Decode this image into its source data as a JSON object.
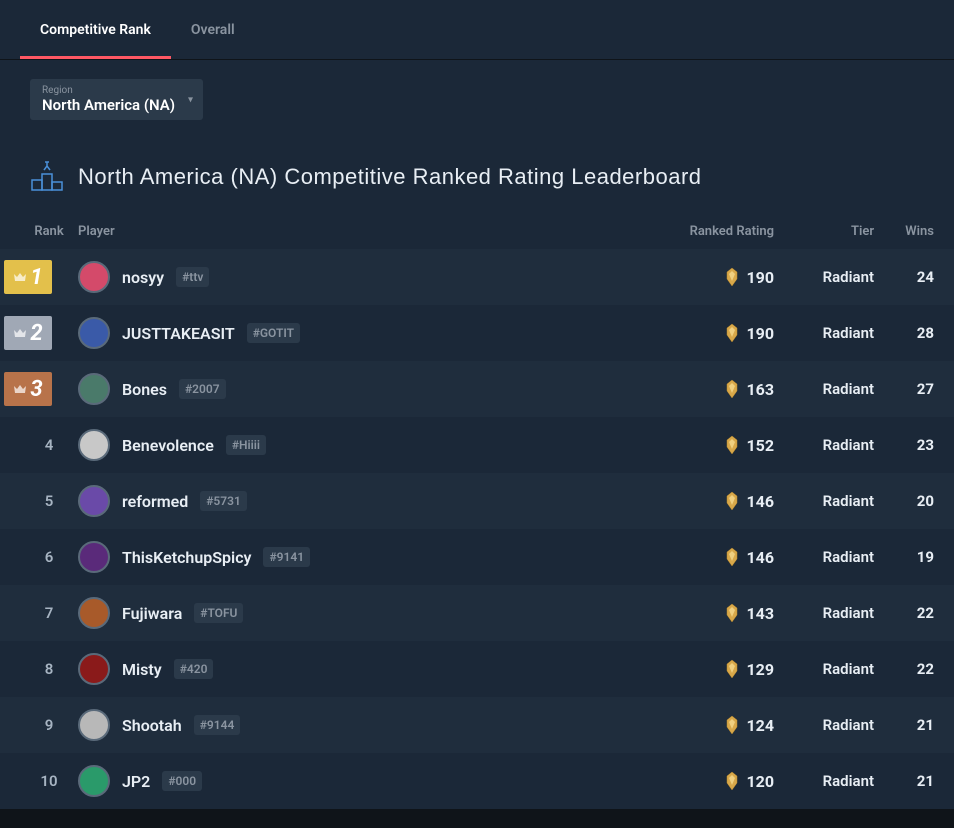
{
  "tabs": {
    "competitive": "Competitive Rank",
    "overall": "Overall"
  },
  "region": {
    "label": "Region",
    "value": "North America (NA)"
  },
  "heading": "North America (NA) Competitive Ranked Rating Leaderboard",
  "columns": {
    "rank": "Rank",
    "player": "Player",
    "rating": "Ranked Rating",
    "tier": "Tier",
    "wins": "Wins"
  },
  "rows": [
    {
      "rank": 1,
      "name": "nosyy",
      "tag": "#ttv",
      "rating": 190,
      "tier": "Radiant",
      "wins": 24,
      "avatarColor": "#d44a6a"
    },
    {
      "rank": 2,
      "name": "JUSTTAKEASIT",
      "tag": "#GOTIT",
      "rating": 190,
      "tier": "Radiant",
      "wins": 28,
      "avatarColor": "#3a5aa8"
    },
    {
      "rank": 3,
      "name": "Bones",
      "tag": "#2007",
      "rating": 163,
      "tier": "Radiant",
      "wins": 27,
      "avatarColor": "#4a7a6a"
    },
    {
      "rank": 4,
      "name": "Benevolence",
      "tag": "#Hiiii",
      "rating": 152,
      "tier": "Radiant",
      "wins": 23,
      "avatarColor": "#c8c8c8"
    },
    {
      "rank": 5,
      "name": "reformed",
      "tag": "#5731",
      "rating": 146,
      "tier": "Radiant",
      "wins": 20,
      "avatarColor": "#6a4aa8"
    },
    {
      "rank": 6,
      "name": "ThisKetchupSpicy",
      "tag": "#9141",
      "rating": 146,
      "tier": "Radiant",
      "wins": 19,
      "avatarColor": "#5a2a7a"
    },
    {
      "rank": 7,
      "name": "Fujiwara",
      "tag": "#TOFU",
      "rating": 143,
      "tier": "Radiant",
      "wins": 22,
      "avatarColor": "#a85a2a"
    },
    {
      "rank": 8,
      "name": "Misty",
      "tag": "#420",
      "rating": 129,
      "tier": "Radiant",
      "wins": 22,
      "avatarColor": "#8a1a1a"
    },
    {
      "rank": 9,
      "name": "Shootah",
      "tag": "#9144",
      "rating": 124,
      "tier": "Radiant",
      "wins": 21,
      "avatarColor": "#b8b8b8"
    },
    {
      "rank": 10,
      "name": "JP2",
      "tag": "#000",
      "rating": 120,
      "tier": "Radiant",
      "wins": 21,
      "avatarColor": "#2a9a6a"
    }
  ]
}
